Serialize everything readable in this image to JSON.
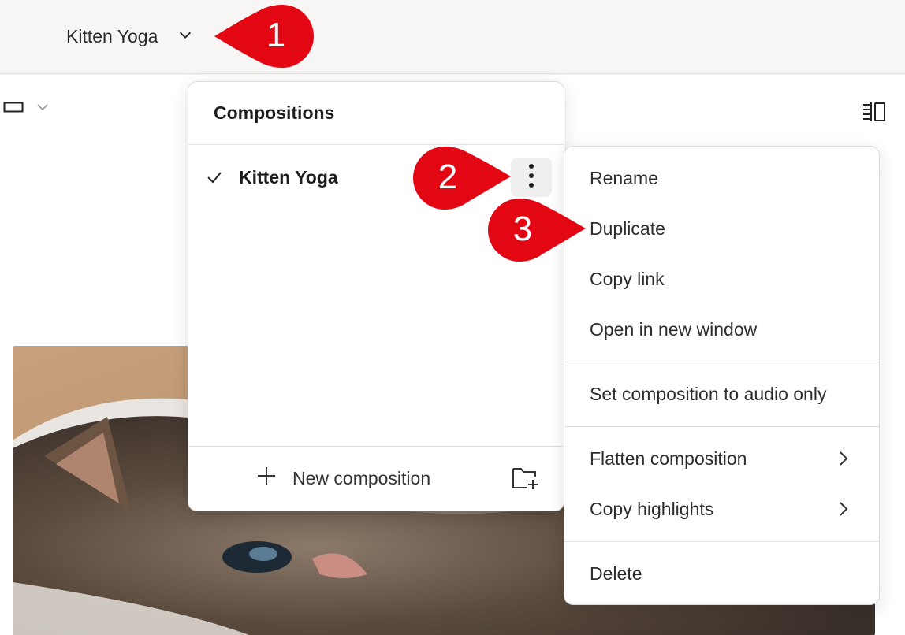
{
  "header": {
    "composition_title": "Kitten Yoga"
  },
  "compositions_panel": {
    "title": "Compositions",
    "items": [
      {
        "name": "Kitten Yoga",
        "selected": true
      }
    ],
    "footer": {
      "new_composition_label": "New composition"
    }
  },
  "context_menu": {
    "groups": [
      [
        "Rename",
        "Duplicate",
        "Copy link",
        "Open in new window"
      ],
      [
        "Set composition to audio only"
      ],
      [
        "Flatten composition",
        "Copy highlights"
      ],
      [
        "Delete"
      ]
    ],
    "items": {
      "rename": "Rename",
      "duplicate": "Duplicate",
      "copy_link": "Copy link",
      "open_new_window": "Open in new window",
      "audio_only": "Set composition to audio only",
      "flatten": "Flatten composition",
      "copy_highlights": "Copy highlights",
      "delete": "Delete"
    }
  },
  "callouts": [
    {
      "number": "1"
    },
    {
      "number": "2"
    },
    {
      "number": "3"
    }
  ],
  "colors": {
    "callout_red": "#e30613",
    "accent_text": "#1f1f1f",
    "topbar_bg": "#f7f6f4"
  },
  "icons": [
    "chevron-down-icon",
    "checkmark-icon",
    "more-vertical-icon",
    "plus-icon",
    "new-folder-icon",
    "chevron-right-icon",
    "layout-icon",
    "sidebar-toggle-icon"
  ]
}
